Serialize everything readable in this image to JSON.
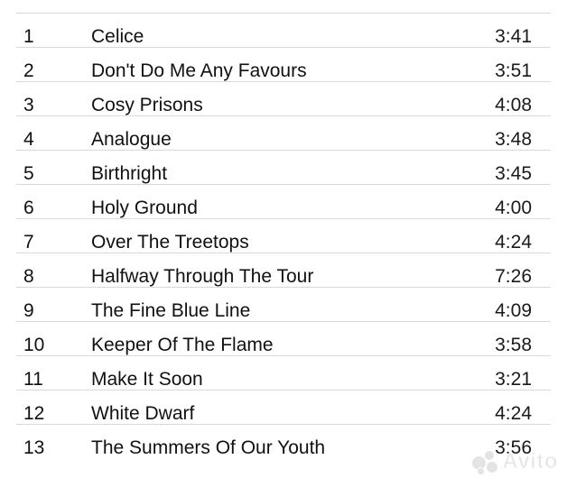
{
  "tracks": [
    {
      "num": "1",
      "title": "Celice",
      "duration": "3:41"
    },
    {
      "num": "2",
      "title": "Don't Do Me Any Favours",
      "duration": "3:51"
    },
    {
      "num": "3",
      "title": "Cosy Prisons",
      "duration": "4:08"
    },
    {
      "num": "4",
      "title": "Analogue",
      "duration": "3:48"
    },
    {
      "num": "5",
      "title": "Birthright",
      "duration": "3:45"
    },
    {
      "num": "6",
      "title": "Holy Ground",
      "duration": "4:00"
    },
    {
      "num": "7",
      "title": "Over The Treetops",
      "duration": "4:24"
    },
    {
      "num": "8",
      "title": "Halfway Through The Tour",
      "duration": "7:26"
    },
    {
      "num": "9",
      "title": "The Fine Blue Line",
      "duration": "4:09"
    },
    {
      "num": "10",
      "title": "Keeper Of The Flame",
      "duration": "3:58"
    },
    {
      "num": "11",
      "title": "Make It Soon",
      "duration": "3:21"
    },
    {
      "num": "12",
      "title": "White Dwarf",
      "duration": "4:24"
    },
    {
      "num": "13",
      "title": "The Summers Of Our Youth",
      "duration": "3:56"
    }
  ],
  "watermark": {
    "text": "Avito",
    "icon": "avito-logo-icon"
  }
}
